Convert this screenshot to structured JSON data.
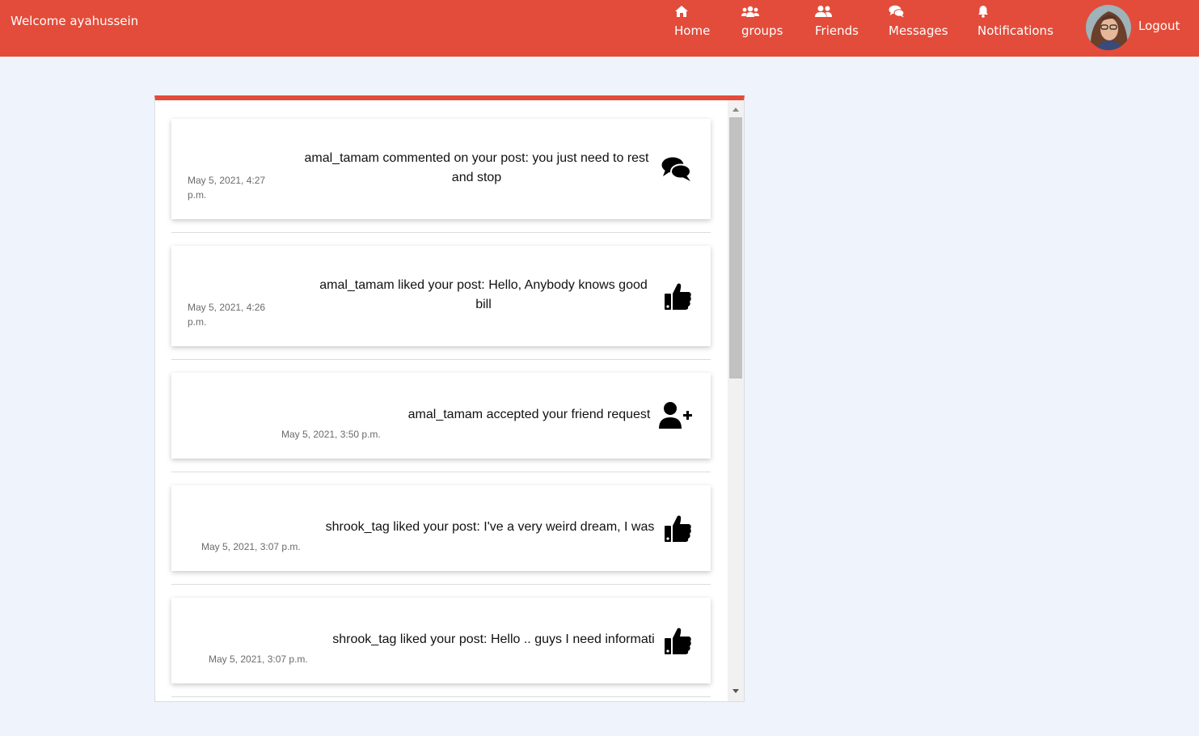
{
  "header": {
    "welcome": "Welcome ayahussein",
    "nav": [
      {
        "label": "Home",
        "icon": "home-icon"
      },
      {
        "label": "groups",
        "icon": "groups-icon"
      },
      {
        "label": "Friends",
        "icon": "friends-icon"
      },
      {
        "label": "Messages",
        "icon": "messages-icon"
      },
      {
        "label": "Notifications",
        "icon": "bell-icon"
      }
    ],
    "logout": "Logout"
  },
  "notifications": [
    {
      "text_line1": "amal_tamam commented on your post: you just need to rest",
      "text_line2": "and stop",
      "date_line1": "May 5, 2021, 4:27",
      "date_line2": "p.m.",
      "icon": "comments-icon"
    },
    {
      "text_line1": "amal_tamam liked your post: Hello, Anybody knows good",
      "text_line2": "bill",
      "date_line1": "May 5, 2021, 4:26",
      "date_line2": "p.m.",
      "icon": "thumbs-up-icon"
    },
    {
      "text_line1": "amal_tamam accepted your friend request",
      "date_line1": "May 5, 2021, 3:50 p.m.",
      "icon": "user-plus-icon"
    },
    {
      "text_line1": "shrook_tag liked your post: I've a very weird dream, I was",
      "date_line1": "May 5, 2021, 3:07 p.m.",
      "icon": "thumbs-up-icon"
    },
    {
      "text_line1": "shrook_tag liked your post: Hello .. guys I need informati",
      "date_line1": "May 5, 2021, 3:07 p.m.",
      "icon": "thumbs-up-icon"
    }
  ],
  "colors": {
    "brand": "#e34c3a",
    "background": "#eff3fb"
  }
}
